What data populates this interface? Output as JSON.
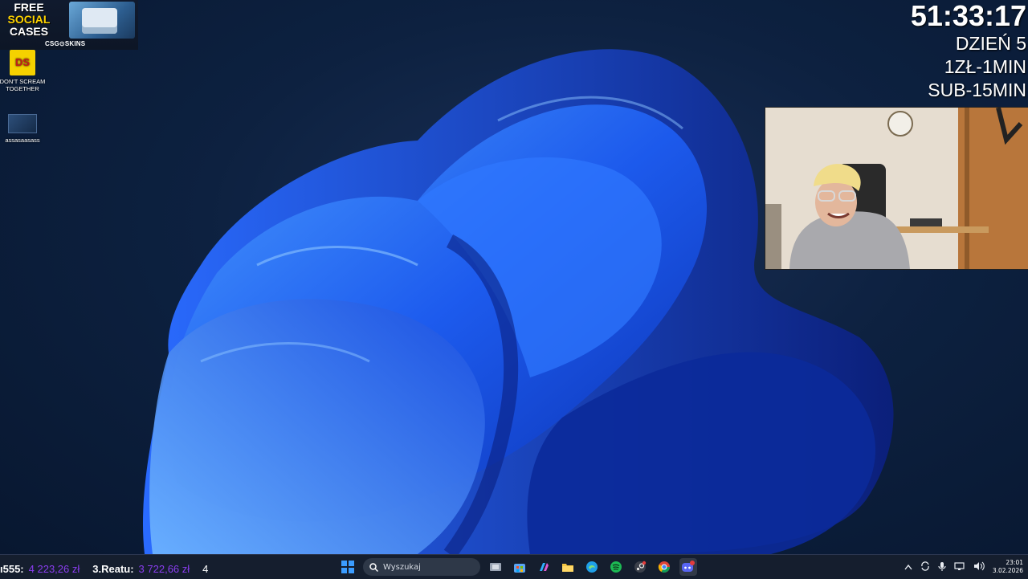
{
  "promo": {
    "line1": "FREE",
    "line2": "SOCIAL",
    "line3": "CASES",
    "brand": "CSG⊙SKINS"
  },
  "desktop_icons": [
    {
      "label_line1": "DON'T SCREAM",
      "label_line2": "TOGETHER",
      "glyph": "DS",
      "icon": "dont-scream-together-icon"
    },
    {
      "label_line1": "assasaasass",
      "label_line2": "",
      "icon": "image-thumbnail-icon"
    }
  ],
  "overlay": {
    "timer": "51:33:17",
    "day": "DZIEŃ 5",
    "rate_money": "1ZŁ-1MIN",
    "rate_sub": "SUB-15MIN"
  },
  "ticker": {
    "entry1_name": "ı555:",
    "entry1_amount": "4 223,26 zł",
    "entry2_name": "3.Reatu:",
    "entry2_amount": "3 722,66 zł",
    "entry3_name": "4"
  },
  "taskbar": {
    "search_placeholder": "Wyszukaj",
    "time": "23:01",
    "date": "3.02.2026",
    "discord_badge": "10",
    "colors": {
      "start": "#3b9cff",
      "spotify": "#1db954",
      "edge": "#1fa0e8",
      "discord": "#5865f2"
    }
  }
}
